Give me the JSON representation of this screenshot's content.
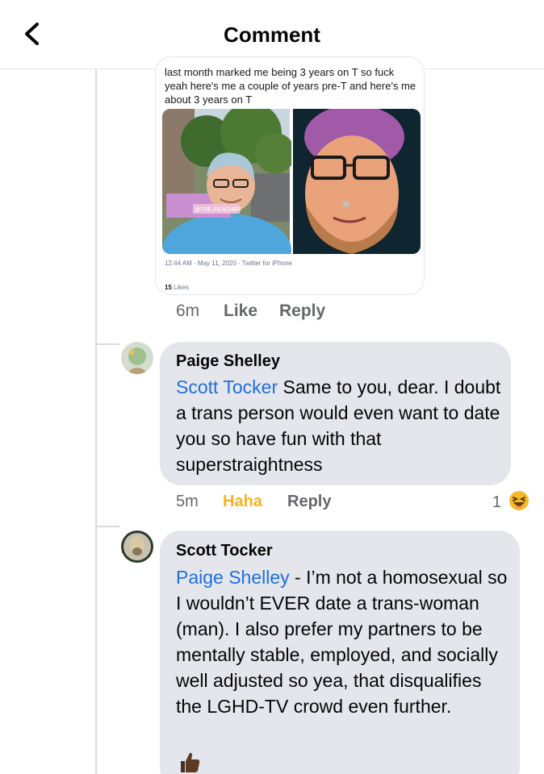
{
  "header": {
    "title": "Comment",
    "back_icon": "chevron-left-icon"
  },
  "embedded_tweet": {
    "text": "last month marked me being 3 years on T so fuck yeah here's me a couple of years pre-T and here's me about 3 years on T",
    "watermark": "@THE.PILACHER",
    "meta": "12:44 AM · May 11, 2020 · Twitter for iPhone",
    "likes_count": "15",
    "likes_label": "Likes"
  },
  "first_comment_actions": {
    "time": "6m",
    "like": "Like",
    "reply": "Reply"
  },
  "comments": [
    {
      "author": "Paige Shelley",
      "mention": "Scott Tocker",
      "text": " Same to you, dear. I doubt a trans person would even want to date you so have fun with that superstraightness",
      "time": "5m",
      "reaction_label": "Haha",
      "reply": "Reply",
      "reaction_count": "1"
    },
    {
      "author": "Scott Tocker",
      "mention": "Paige Shelley",
      "text": " - I’m not a homosexual so I wouldn’t EVER date a trans-woman (man). I also prefer my partners to be mentally stable, employed, and socially well adjusted so yea, that disqualifies the LGHD-TV crowd even further.",
      "reaction_icon": "thumbs-up-icon"
    }
  ],
  "colors": {
    "mention": "#216fdb",
    "haha": "#f7b125",
    "bubble": "#e4e6eb",
    "muted": "#65676b"
  }
}
